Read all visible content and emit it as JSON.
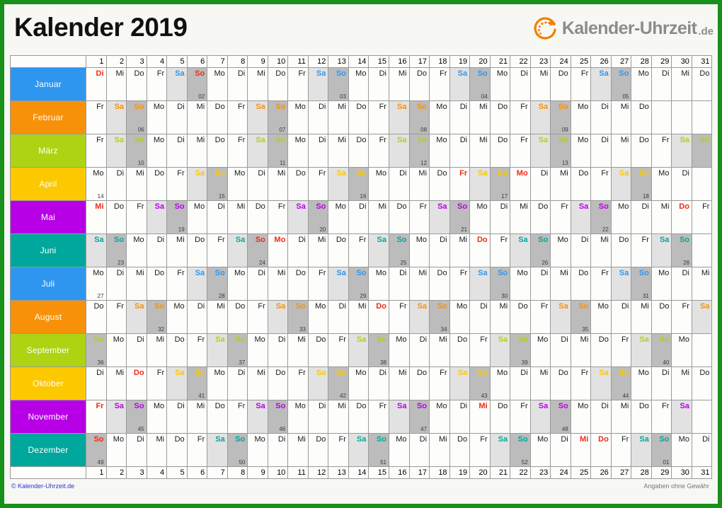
{
  "header": {
    "title": "Kalender 2019",
    "logo": {
      "icon": "clock-arrow-icon",
      "name": "Kalender-Uhrzeit",
      "tld": ".de"
    }
  },
  "colors": {
    "border": "#18911b",
    "page_bg": "#f7f8f4",
    "saturday_bg": "#e2e2e2",
    "sunday_bg": "#bcbcbc",
    "holiday_text": "#f02a14",
    "grid_line": "#9a9a9a",
    "copyright_text": "#3333cc",
    "disclaimer_text": "#777777",
    "logo_text": "#8c8c8c",
    "logo_mark": "#f08000"
  },
  "day_numbers": [
    1,
    2,
    3,
    4,
    5,
    6,
    7,
    8,
    9,
    10,
    11,
    12,
    13,
    14,
    15,
    16,
    17,
    18,
    19,
    20,
    21,
    22,
    23,
    24,
    25,
    26,
    27,
    28,
    29,
    30,
    31
  ],
  "weekday_abbr": {
    "1": "Mo",
    "2": "Di",
    "3": "Mi",
    "4": "Do",
    "5": "Fr",
    "6": "Sa",
    "7": "So"
  },
  "months": [
    {
      "name": "Januar",
      "color": "#2e96ee",
      "days": 31,
      "first_weekday": 2,
      "holidays": [
        1,
        6
      ],
      "week_marks": {
        "6": "02",
        "13": "03",
        "20": "04",
        "27": "05"
      }
    },
    {
      "name": "Februar",
      "color": "#f79109",
      "days": 28,
      "first_weekday": 5,
      "holidays": [],
      "week_marks": {
        "3": "06",
        "10": "07",
        "17": "08",
        "24": "09"
      }
    },
    {
      "name": "März",
      "color": "#aed313",
      "days": 31,
      "first_weekday": 5,
      "holidays": [],
      "week_marks": {
        "3": "10",
        "10": "11",
        "17": "12",
        "24": "13"
      }
    },
    {
      "name": "April",
      "color": "#fcc800",
      "days": 30,
      "first_weekday": 1,
      "holidays": [
        19,
        22
      ],
      "week_marks": {
        "1": "14",
        "7": "15",
        "14": "16",
        "21": "17",
        "28": "18"
      }
    },
    {
      "name": "Mai",
      "color": "#b800e6",
      "days": 31,
      "first_weekday": 3,
      "holidays": [
        1,
        30
      ],
      "week_marks": {
        "5": "19",
        "12": "20",
        "19": "21",
        "26": "22"
      }
    },
    {
      "name": "Juni",
      "color": "#00a79c",
      "days": 30,
      "first_weekday": 6,
      "holidays": [
        9,
        10,
        20
      ],
      "week_marks": {
        "2": "23",
        "9": "24",
        "16": "25",
        "23": "26",
        "30": "28"
      }
    },
    {
      "name": "Juli",
      "color": "#2e96ee",
      "days": 31,
      "first_weekday": 1,
      "holidays": [],
      "week_marks": {
        "1": "27",
        "7": "28",
        "14": "29",
        "21": "30",
        "28": "31"
      }
    },
    {
      "name": "August",
      "color": "#f79109",
      "days": 31,
      "first_weekday": 4,
      "holidays": [
        15
      ],
      "week_marks": {
        "4": "32",
        "11": "33",
        "18": "34",
        "25": "35"
      }
    },
    {
      "name": "September",
      "color": "#aed313",
      "days": 30,
      "first_weekday": 7,
      "holidays": [],
      "week_marks": {
        "1": "36",
        "8": "37",
        "15": "38",
        "22": "39",
        "29": "40"
      }
    },
    {
      "name": "Oktober",
      "color": "#fcc800",
      "days": 31,
      "first_weekday": 2,
      "holidays": [
        3
      ],
      "week_marks": {
        "6": "41",
        "13": "42",
        "20": "43",
        "27": "44"
      }
    },
    {
      "name": "November",
      "color": "#b800e6",
      "days": 30,
      "first_weekday": 5,
      "holidays": [
        1,
        20
      ],
      "week_marks": {
        "3": "45",
        "10": "46",
        "17": "47",
        "24": "48"
      }
    },
    {
      "name": "Dezember",
      "color": "#00a79c",
      "days": 31,
      "first_weekday": 7,
      "holidays": [
        1,
        25,
        26
      ],
      "week_marks": {
        "1": "49",
        "8": "50",
        "15": "51",
        "22": "52",
        "29": "01"
      }
    }
  ],
  "footer": {
    "copyright": "© Kalender-Uhrzeit.de",
    "disclaimer": "Angaben ohne Gewähr"
  }
}
